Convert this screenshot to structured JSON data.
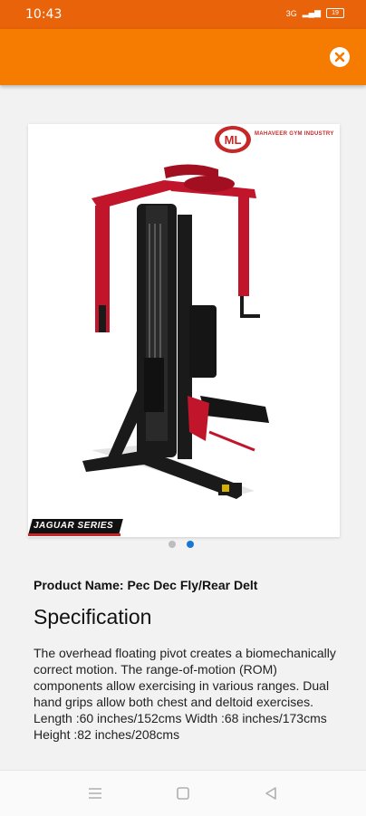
{
  "status_bar": {
    "time": "10:43",
    "network": "3G",
    "battery": "19"
  },
  "product": {
    "image_alt": "Pec Dec Fly/Rear Delt machine",
    "brand_name": "MAHAVEER GYM INDUSTRY",
    "brand_initials": "ML",
    "series_label": "JAGUAR SERIES",
    "name_label": "Product Name: Pec Dec Fly/Rear Delt",
    "image_count": 2,
    "active_image": 2
  },
  "specification": {
    "heading": "Specification",
    "body": "The overhead floating pivot creates a biomechanically correct motion. The range-of-motion (ROM) components allow exercising in various ranges. Dual hand grips allow both chest and deltoid exercises. Length :60 inches/152cms Width :68 inches/173cms Height :82 inches/208cms"
  },
  "colors": {
    "status_bar": "#e8630a",
    "app_bar": "#f57c00",
    "frame_red": "#c0152a",
    "frame_black": "#1a1a1a",
    "dot_active": "#1976d2"
  },
  "icons": {
    "close": "close-circle-icon",
    "menu": "menu-icon",
    "home": "home-square-icon",
    "back": "back-triangle-icon"
  }
}
